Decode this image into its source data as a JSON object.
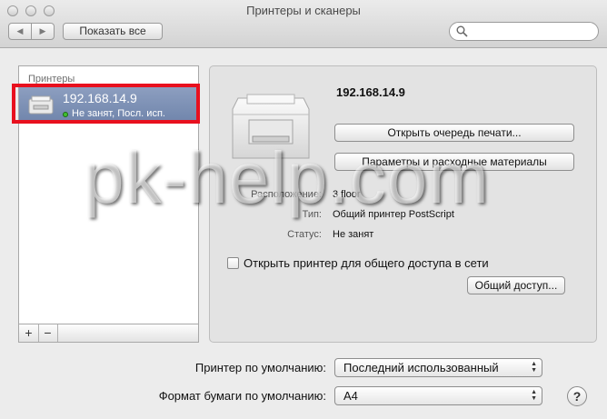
{
  "window": {
    "title": "Принтеры и сканеры",
    "show_all_label": "Показать все",
    "back_glyph": "◀",
    "forward_glyph": "▶"
  },
  "sidebar": {
    "header": "Принтеры",
    "items": [
      {
        "name": "192.168.14.9",
        "status": "Не занят, Посл. исп.",
        "selected": true
      }
    ],
    "add_label": "+",
    "remove_label": "−"
  },
  "details": {
    "printer_name": "192.168.14.9",
    "open_queue_label": "Открыть очередь печати...",
    "options_label": "Параметры и расходные материалы",
    "location_label": "Расположение:",
    "location_value": "3 floor",
    "type_label": "Тип:",
    "type_value": "Общий принтер PostScript",
    "status_label": "Статус:",
    "status_value": "Не занят",
    "share_checkbox_label": "Открыть принтер для общего доступа в сети",
    "share_checked": false,
    "sharing_button_label": "Общий доступ..."
  },
  "footer": {
    "default_printer_label": "Принтер по умолчанию:",
    "default_printer_value": "Последний использованный",
    "paper_size_label": "Формат бумаги по умолчанию:",
    "paper_size_value": "A4",
    "help_label": "?"
  },
  "watermark": "pk-help.com",
  "colors": {
    "selection": "#7e91b6",
    "status_dot": "#3fbf2e",
    "highlight_box": "#e8101e"
  }
}
